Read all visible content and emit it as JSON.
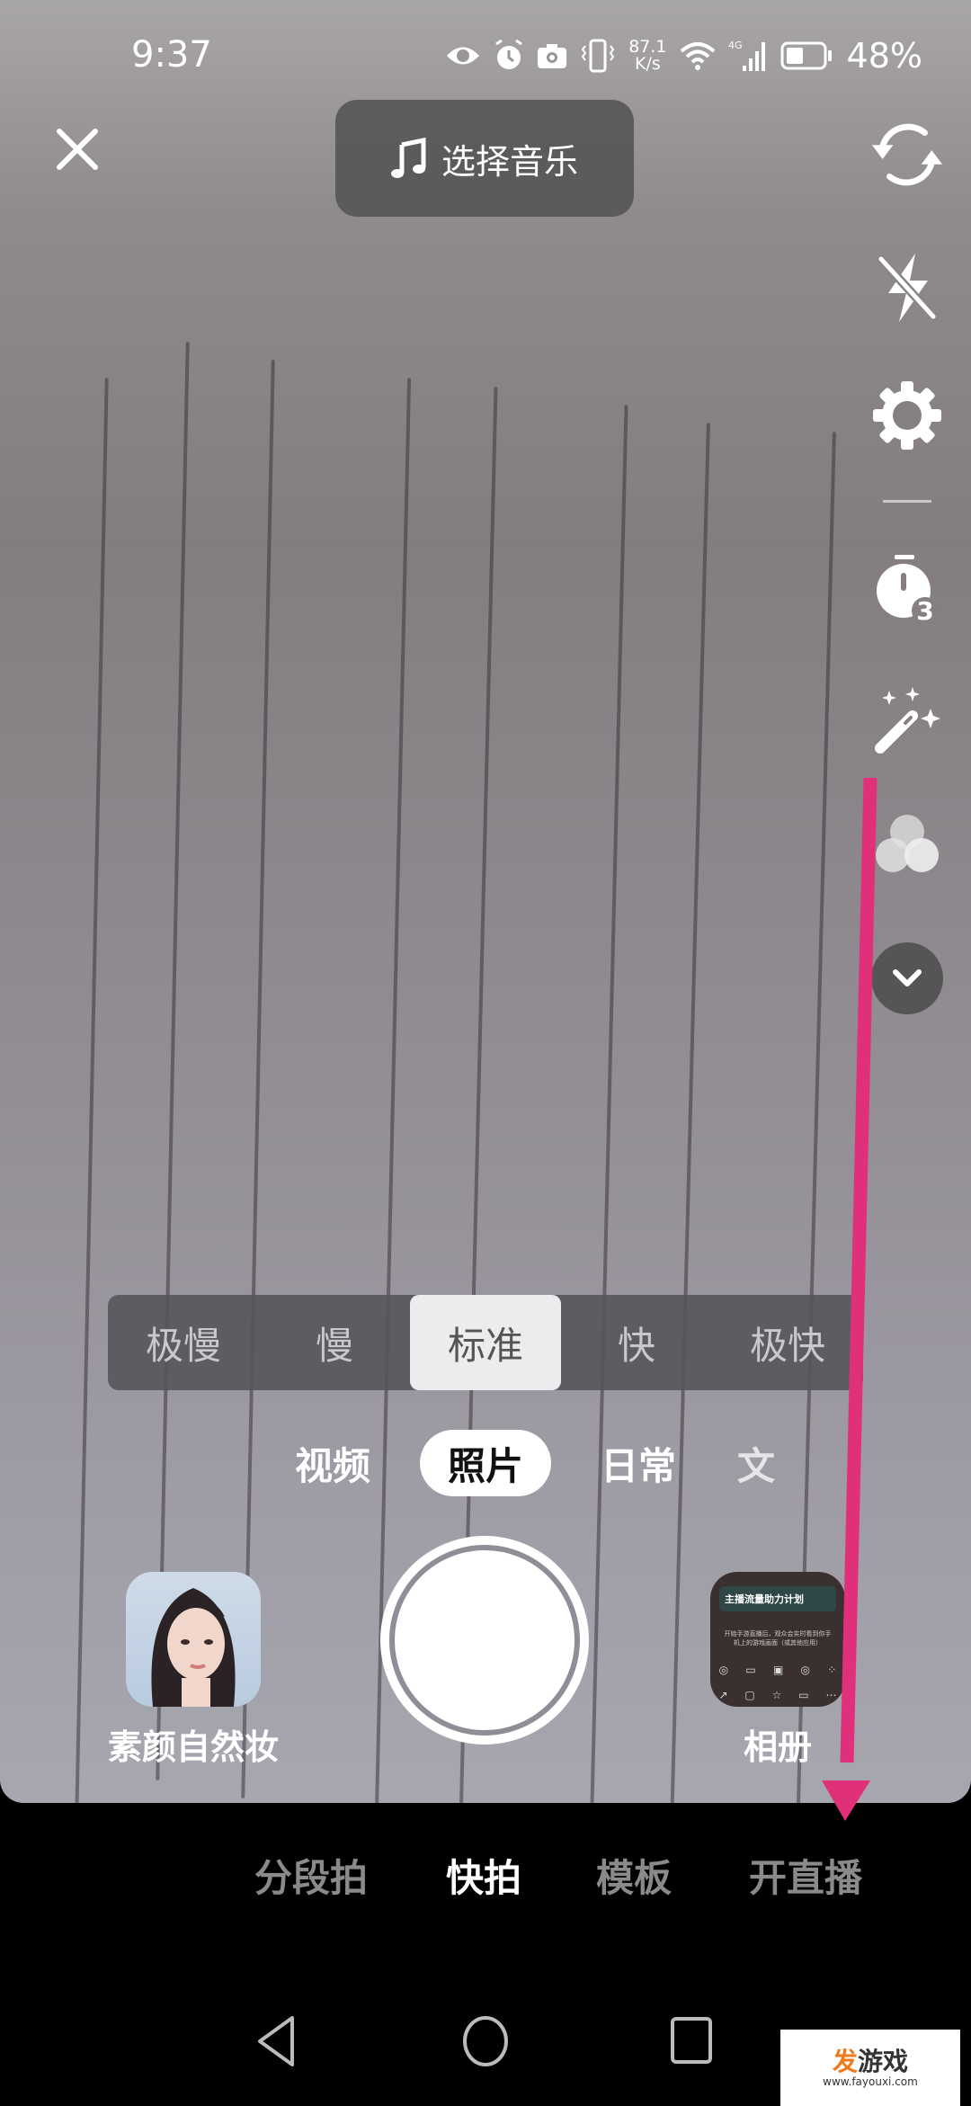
{
  "status_bar": {
    "time": "9:37",
    "network_speed_value": "87.1",
    "network_speed_unit": "K/s",
    "cellular": "4G",
    "battery_percent": "48%",
    "battery_level": 0.48,
    "icons": [
      "eye-icon",
      "alarm-icon",
      "camera-icon",
      "vibrate-icon",
      "wifi-icon",
      "signal-icon",
      "battery-icon"
    ]
  },
  "top": {
    "close_icon": "close-icon",
    "music_label": "选择音乐",
    "music_icon": "music-note-icon"
  },
  "side_toolbar": [
    {
      "name": "flip-camera",
      "icon": "flip-camera-icon"
    },
    {
      "name": "flash-off",
      "icon": "flash-off-icon"
    },
    {
      "name": "settings",
      "icon": "gear-icon"
    },
    {
      "name": "timer",
      "icon": "timer-icon",
      "badge": "3"
    },
    {
      "name": "beauty",
      "icon": "magic-wand-icon"
    },
    {
      "name": "filter",
      "icon": "filter-circles-icon"
    },
    {
      "name": "more",
      "icon": "chevron-down-icon"
    }
  ],
  "speed": {
    "options": [
      "极慢",
      "慢",
      "标准",
      "快",
      "极快"
    ],
    "selected": "标准"
  },
  "modes": {
    "options": [
      "视频",
      "照片",
      "日常",
      "文"
    ],
    "selected": "照片"
  },
  "effect": {
    "label": "素颜自然妆"
  },
  "album": {
    "label": "相册",
    "preview_title": "主播流量助力计划",
    "preview_text": "开始手游直播后，观众会实时看到你手机上的游戏画面（或其他应用）"
  },
  "bottom_tabs": {
    "options": [
      "分段拍",
      "快拍",
      "模板",
      "开直播"
    ],
    "selected": "快拍"
  },
  "nav": {
    "back": "back-icon",
    "home": "home-icon",
    "recents": "recents-icon"
  },
  "annotation": {
    "color": "#e0307a",
    "type": "arrow-down"
  },
  "watermark": {
    "brand_accent": "发",
    "brand_rest": "游戏",
    "url": "www.fayouxi.com"
  }
}
